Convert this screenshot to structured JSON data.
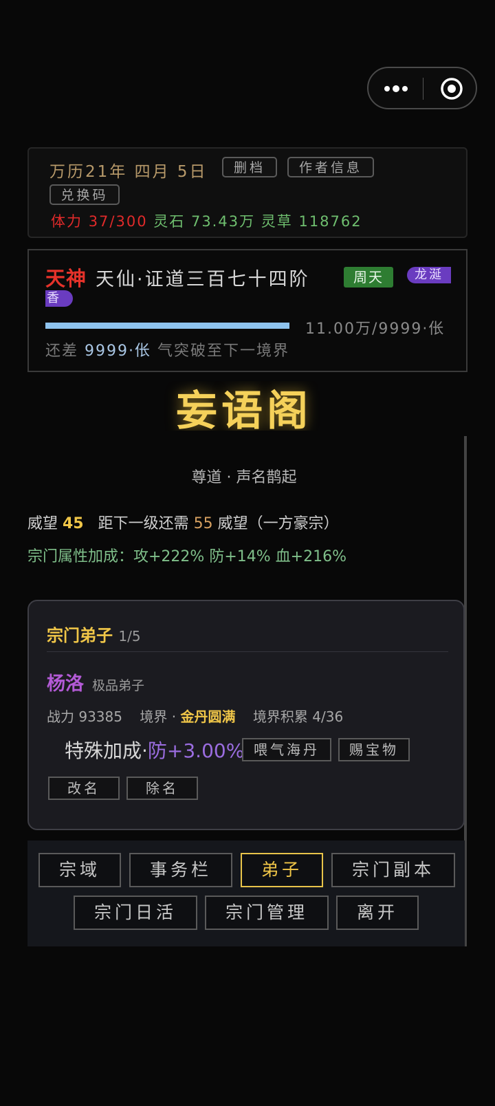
{
  "header": {
    "date": "万历21年  四月  5日",
    "delete_save": "删档",
    "author_info": "作者信息",
    "redeem_code": "兑换码",
    "stamina_label": "体力",
    "stamina_value": "37/300",
    "spirit_stone_label": "灵石",
    "spirit_stone_value": "73.43万",
    "spirit_herb_label": "灵草",
    "spirit_herb_value": "118762"
  },
  "realm": {
    "title_tag": "天神",
    "realm_name": "天仙·证道三百七十四阶",
    "badge_cycle": "周天",
    "badge_incense_1": "龙涎",
    "badge_incense_2": "香",
    "qi_progress": 1.0,
    "qi_value": "11.00万/9999·伥",
    "gap_prefix": "还差 ",
    "gap_value": "9999·伥",
    "gap_suffix": " 气突破至下一境界"
  },
  "sect": {
    "name": "妄语阁",
    "subtitle": "尊道 · 声名鹊起",
    "prestige_label": "威望 ",
    "prestige_value": "45",
    "next_level_prefix": "距下一级还需 ",
    "next_level_value": "55",
    "next_level_suffix": " 威望（一方豪宗）",
    "bonus": "宗门属性加成：攻+222%    防+14%    血+216%"
  },
  "disciples": {
    "title": "宗门弟子",
    "count": "1/5",
    "items": [
      {
        "name": "杨洛",
        "rank": "极品弟子",
        "power": "战力 93385",
        "realm_label": "境界 · ",
        "realm_value": "金丹圆满",
        "accum": "境界积累 4/36",
        "special_label": "特殊加成·",
        "special_value": "防+3.00%",
        "feed_button": "喂气海丹",
        "gift_button": "赐宝物",
        "rename_button": "改名",
        "dismiss_button": "除名"
      }
    ]
  },
  "nav": {
    "items": [
      "宗域",
      "事务栏",
      "弟子",
      "宗门副本",
      "宗门日活",
      "宗门管理",
      "离开"
    ],
    "active": "弟子"
  },
  "colors": {
    "accent_gold": "#f0c648",
    "stamina_red": "#e02a2a",
    "resource_green": "#6fbf6f",
    "disciple_purple": "#b35ad6"
  }
}
